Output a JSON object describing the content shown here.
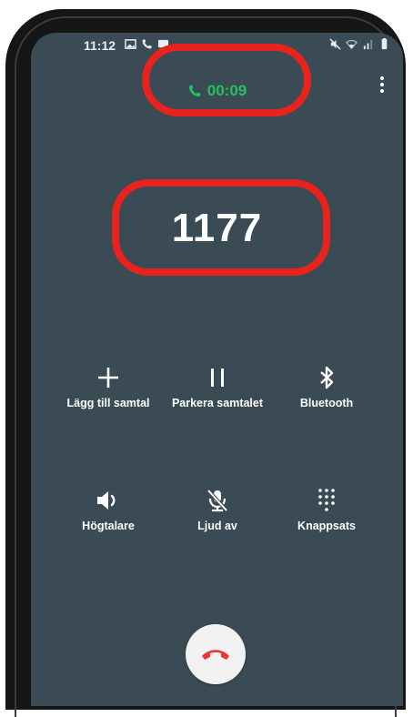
{
  "status_bar": {
    "time": "11:12"
  },
  "call": {
    "timer": "00:09",
    "number": "1177"
  },
  "controls": [
    {
      "label": "Lägg till samtal",
      "icon": "plus-icon"
    },
    {
      "label": "Parkera samtalet",
      "icon": "pause-icon"
    },
    {
      "label": "Bluetooth",
      "icon": "bluetooth-icon"
    },
    {
      "label": "Högtalare",
      "icon": "speaker-icon"
    },
    {
      "label": "Ljud av",
      "icon": "mic-off-icon"
    },
    {
      "label": "Knappsats",
      "icon": "keypad-icon"
    }
  ],
  "colors": {
    "screen_bg": "#3b4b56",
    "timer_green": "#27c05a",
    "annotation_red": "#e8221c",
    "hangup_red": "#e53935"
  }
}
